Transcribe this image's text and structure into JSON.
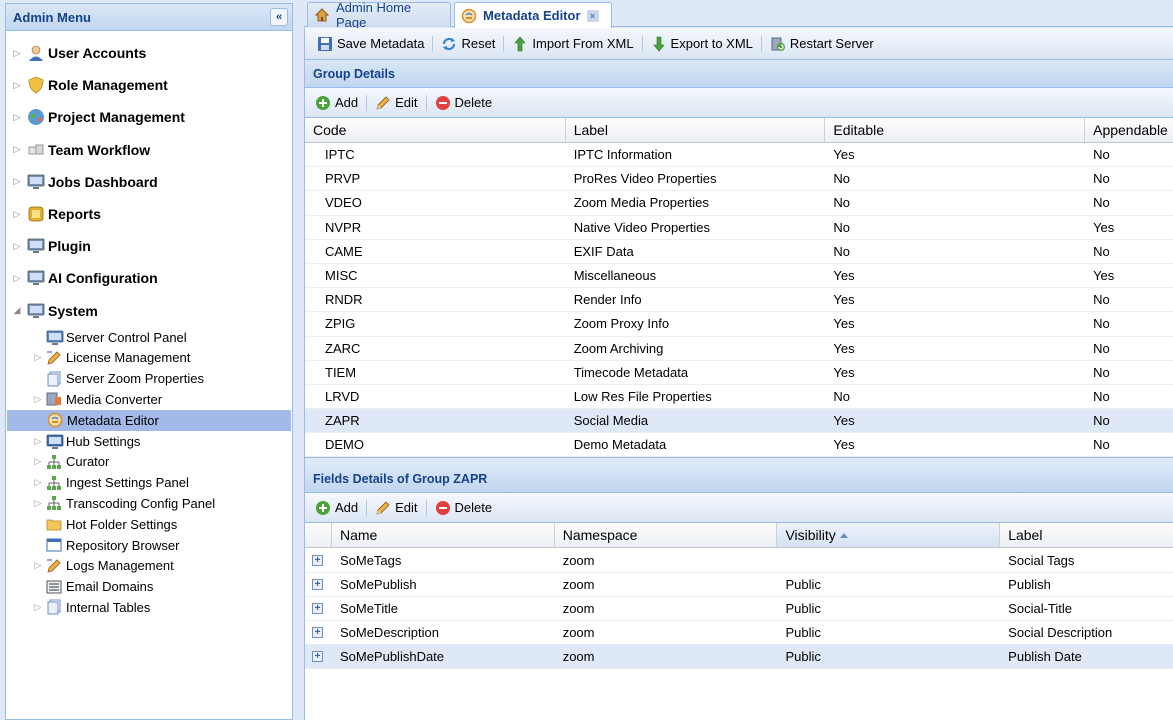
{
  "sidebar": {
    "title": "Admin Menu",
    "collapse_glyph": "«",
    "top_items": [
      {
        "label": "User Accounts",
        "icon": "user-icon",
        "color": "#e38b3c"
      },
      {
        "label": "Role Management",
        "icon": "shield-icon",
        "color": "#f0c040"
      },
      {
        "label": "Project Management",
        "icon": "globe-icon",
        "color": "#5a9ad6"
      },
      {
        "label": "Team Workflow",
        "icon": "cubes-icon",
        "color": "#c8c8c8"
      },
      {
        "label": "Jobs Dashboard",
        "icon": "monitor-icon",
        "color": "#7d93b3"
      },
      {
        "label": "Reports",
        "icon": "reports-icon",
        "color": "#e0b030"
      },
      {
        "label": "Plugin",
        "icon": "monitor-icon",
        "color": "#7d93b3"
      },
      {
        "label": "AI Configuration",
        "icon": "monitor-icon",
        "color": "#7d93b3"
      },
      {
        "label": "System",
        "icon": "monitor-icon",
        "color": "#7d93b3"
      }
    ],
    "system_items": [
      {
        "label": "Server Control Panel",
        "icon": "monitor-icon",
        "color": "#5b86c9",
        "expandable": false
      },
      {
        "label": "License Management",
        "icon": "pencil-icon",
        "color": "#e8c890",
        "expandable": true
      },
      {
        "label": "Server Zoom Properties",
        "icon": "pages-icon",
        "color": "#a9c4e8",
        "expandable": false
      },
      {
        "label": "Media Converter",
        "icon": "converter-icon",
        "color": "#8ea0b8",
        "expandable": true
      },
      {
        "label": "Metadata Editor",
        "icon": "metadata-icon",
        "color": "#f0a040",
        "expandable": false,
        "selected": true
      },
      {
        "label": "Hub Settings",
        "icon": "monitor-icon",
        "color": "#3f6fb8",
        "expandable": true
      },
      {
        "label": "Curator",
        "icon": "sitemap-icon",
        "color": "#5aa84a",
        "expandable": true
      },
      {
        "label": "Ingest Settings Panel",
        "icon": "sitemap-icon",
        "color": "#5aa84a",
        "expandable": true
      },
      {
        "label": "Transcoding Config Panel",
        "icon": "sitemap-icon",
        "color": "#5aa84a",
        "expandable": true
      },
      {
        "label": "Hot Folder Settings",
        "icon": "folder-icon",
        "color": "#f3c75a",
        "expandable": false
      },
      {
        "label": "Repository Browser",
        "icon": "window-icon",
        "color": "#5a9ad6",
        "expandable": false
      },
      {
        "label": "Logs Management",
        "icon": "pencil-icon",
        "color": "#e8c890",
        "expandable": true
      },
      {
        "label": "Email Domains",
        "icon": "list-icon",
        "color": "#7a8aa0",
        "expandable": false
      },
      {
        "label": "Internal Tables",
        "icon": "pages-icon",
        "color": "#a9c4e8",
        "expandable": true
      }
    ]
  },
  "tabs": [
    {
      "label": "Admin Home Page",
      "icon": "home-icon"
    },
    {
      "label": "Metadata Editor",
      "icon": "metadata-icon",
      "close": "×"
    }
  ],
  "toolbar": {
    "save": "Save Metadata",
    "reset": "Reset",
    "import": "Import From XML",
    "export": "Export to XML",
    "restart": "Restart Server"
  },
  "group_panel": {
    "title": "Group Details",
    "add": "Add",
    "edit": "Edit",
    "delete": "Delete",
    "columns": [
      "Code",
      "Label",
      "Editable",
      "Appendable"
    ],
    "rows": [
      [
        "IPTC",
        "IPTC Information",
        "Yes",
        "No"
      ],
      [
        "PRVP",
        "ProRes Video Properties",
        "No",
        "No"
      ],
      [
        "VDEO",
        "Zoom Media Properties",
        "No",
        "No"
      ],
      [
        "NVPR",
        "Native Video Properties",
        "No",
        "Yes"
      ],
      [
        "CAME",
        "EXIF Data",
        "No",
        "No"
      ],
      [
        "MISC",
        "Miscellaneous",
        "Yes",
        "Yes"
      ],
      [
        "RNDR",
        "Render Info",
        "Yes",
        "No"
      ],
      [
        "ZPIG",
        "Zoom Proxy Info",
        "Yes",
        "No"
      ],
      [
        "ZARC",
        "Zoom Archiving",
        "Yes",
        "No"
      ],
      [
        "TIEM",
        "Timecode Metadata",
        "Yes",
        "No"
      ],
      [
        "LRVD",
        "Low Res File Properties",
        "No",
        "No"
      ],
      [
        "ZAPR",
        "Social Media",
        "Yes",
        "No"
      ],
      [
        "DEMO",
        "Demo Metadata",
        "Yes",
        "No"
      ]
    ],
    "selected_index": 11
  },
  "fields_panel": {
    "title": "Fields Details of Group ZAPR",
    "add": "Add",
    "edit": "Edit",
    "delete": "Delete",
    "columns": [
      "Name",
      "Namespace",
      "Visibility",
      "Label"
    ],
    "rows": [
      [
        "SoMeTags",
        "zoom",
        "",
        "Social Tags"
      ],
      [
        "SoMePublish",
        "zoom",
        "Public",
        "Publish"
      ],
      [
        "SoMeTitle",
        "zoom",
        "Public",
        "Social-Title"
      ],
      [
        "SoMeDescription",
        "zoom",
        "Public",
        "Social Description"
      ],
      [
        "SoMePublishDate",
        "zoom",
        "Public",
        "Publish Date"
      ]
    ],
    "selected_index": 4,
    "expand_glyph": "+"
  }
}
